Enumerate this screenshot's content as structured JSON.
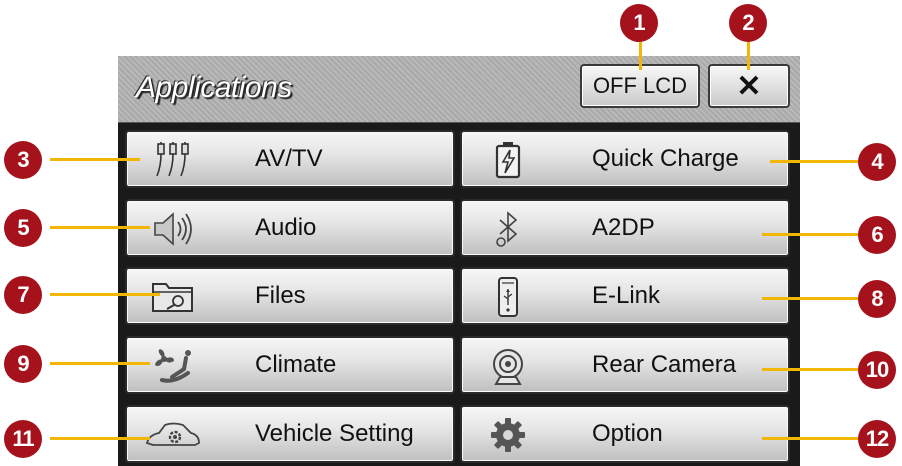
{
  "header": {
    "title": "Applications",
    "off_lcd_label": "OFF LCD",
    "close_label": "✕"
  },
  "apps": {
    "av_tv": "AV/TV",
    "quick_charge": "Quick Charge",
    "audio": "Audio",
    "a2dp": "A2DP",
    "files": "Files",
    "elink": "E-Link",
    "climate": "Climate",
    "rear_camera": "Rear Camera",
    "vehicle_setting": "Vehicle Setting",
    "option": "Option"
  },
  "callouts": [
    "1",
    "2",
    "3",
    "4",
    "5",
    "6",
    "7",
    "8",
    "9",
    "10",
    "11",
    "12"
  ],
  "colors": {
    "badge": "#a5121c",
    "leader": "#f2b705",
    "panel": "#1a1a1a"
  }
}
